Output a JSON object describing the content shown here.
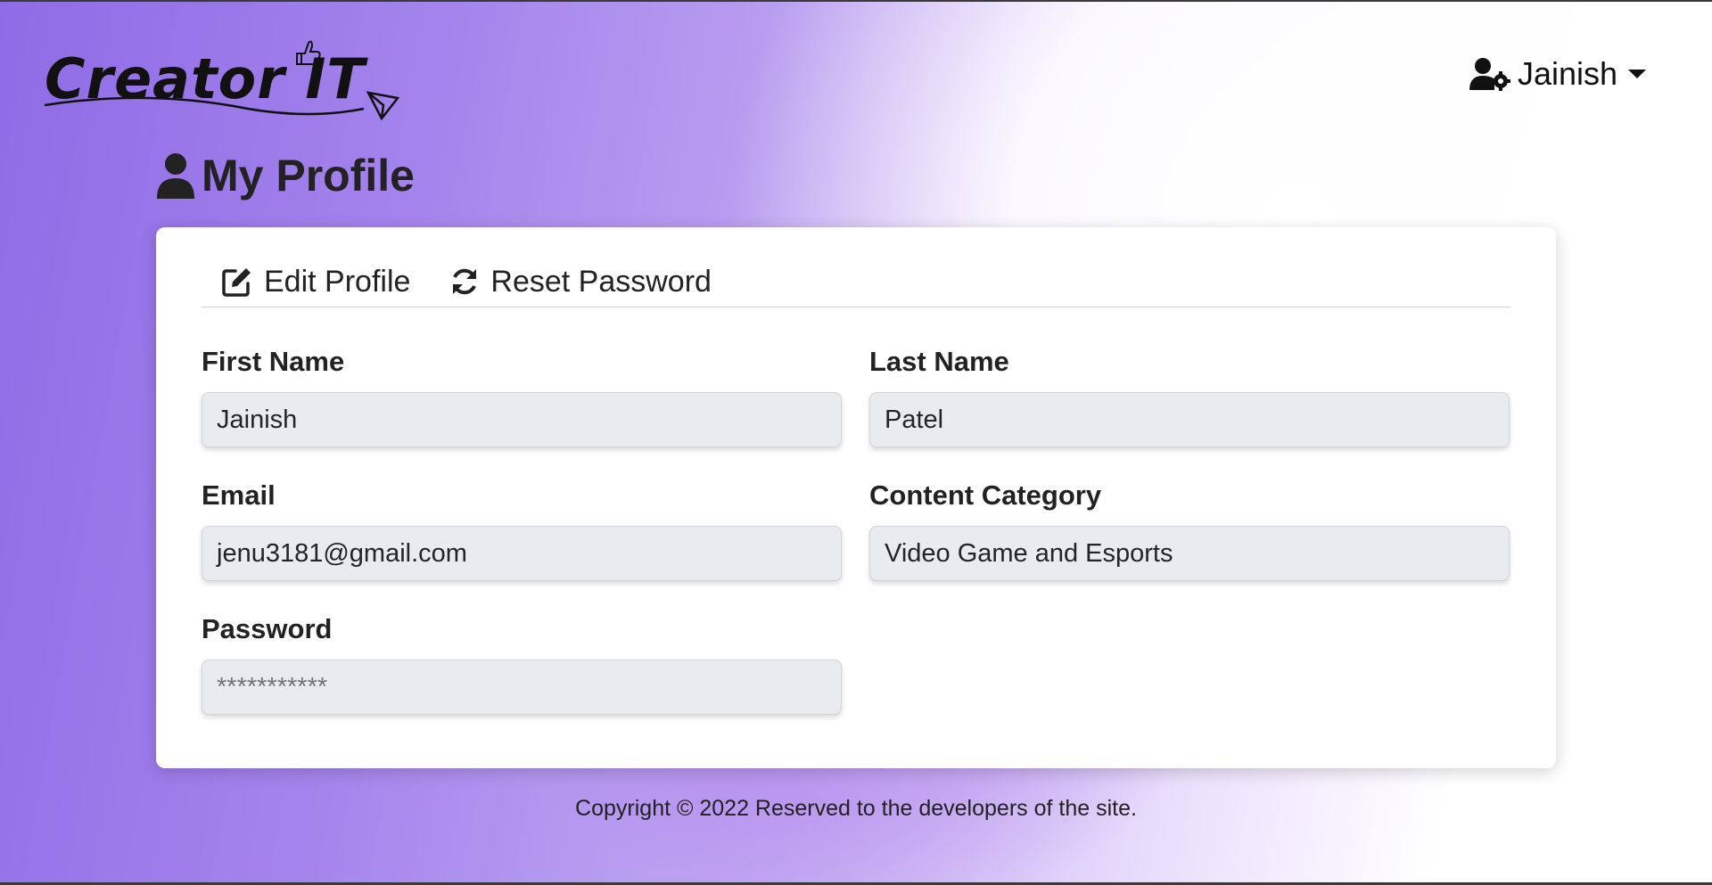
{
  "logo": {
    "text": "Creator IT"
  },
  "user_menu": {
    "name": "Jainish"
  },
  "page": {
    "title": "My Profile"
  },
  "tabs": [
    {
      "label": "Edit Profile",
      "icon": "edit-icon"
    },
    {
      "label": "Reset Password",
      "icon": "refresh-icon"
    }
  ],
  "form": {
    "first_name": {
      "label": "First Name",
      "value": "Jainish"
    },
    "last_name": {
      "label": "Last Name",
      "value": "Patel"
    },
    "email": {
      "label": "Email",
      "value": "jenu3181@gmail.com"
    },
    "content_category": {
      "label": "Content Category",
      "value": "Video Game and Esports"
    },
    "password": {
      "label": "Password",
      "placeholder": "***********"
    }
  },
  "footer": {
    "text": "Copyright © 2022 Reserved to the developers of the site."
  },
  "colors": {
    "accent_purple": "#8f6be6",
    "input_bg": "#e9ecef"
  }
}
